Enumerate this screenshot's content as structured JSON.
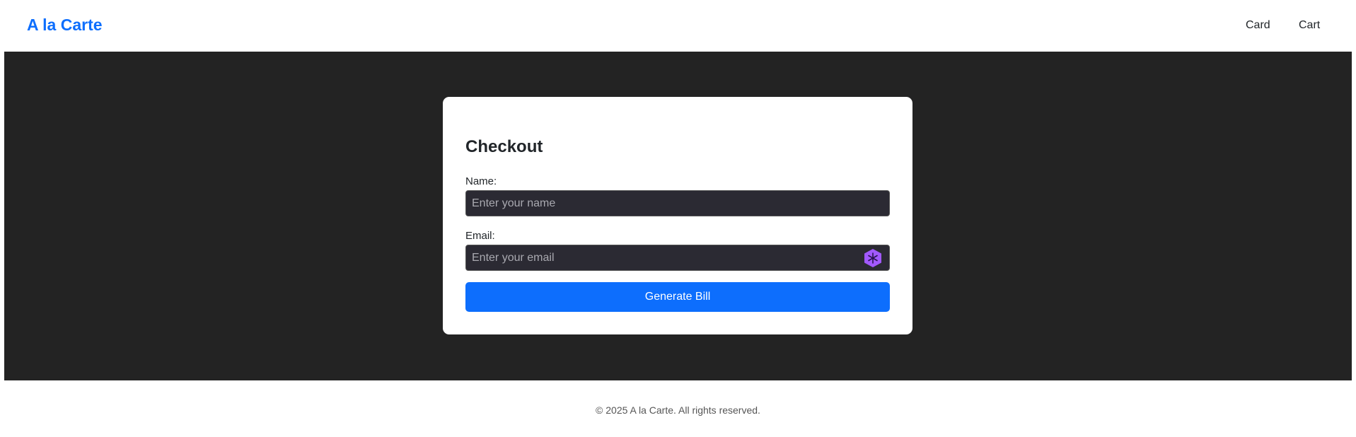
{
  "navbar": {
    "brand": "A la Carte",
    "links": [
      {
        "label": "Card"
      },
      {
        "label": "Cart"
      }
    ]
  },
  "checkout": {
    "title": "Checkout",
    "name_label": "Name:",
    "name_placeholder": "Enter your name",
    "name_value": "",
    "email_label": "Email:",
    "email_placeholder": "Enter your email",
    "email_value": "",
    "submit_label": "Generate Bill",
    "extension_icon": "snowflake-hexagon-icon"
  },
  "footer": {
    "text": "© 2025 A la Carte. All rights reserved."
  },
  "colors": {
    "brand": "#0d6efd",
    "page_background": "#232323",
    "input_background": "#2b2a33",
    "extension_icon": "#a259ff"
  }
}
